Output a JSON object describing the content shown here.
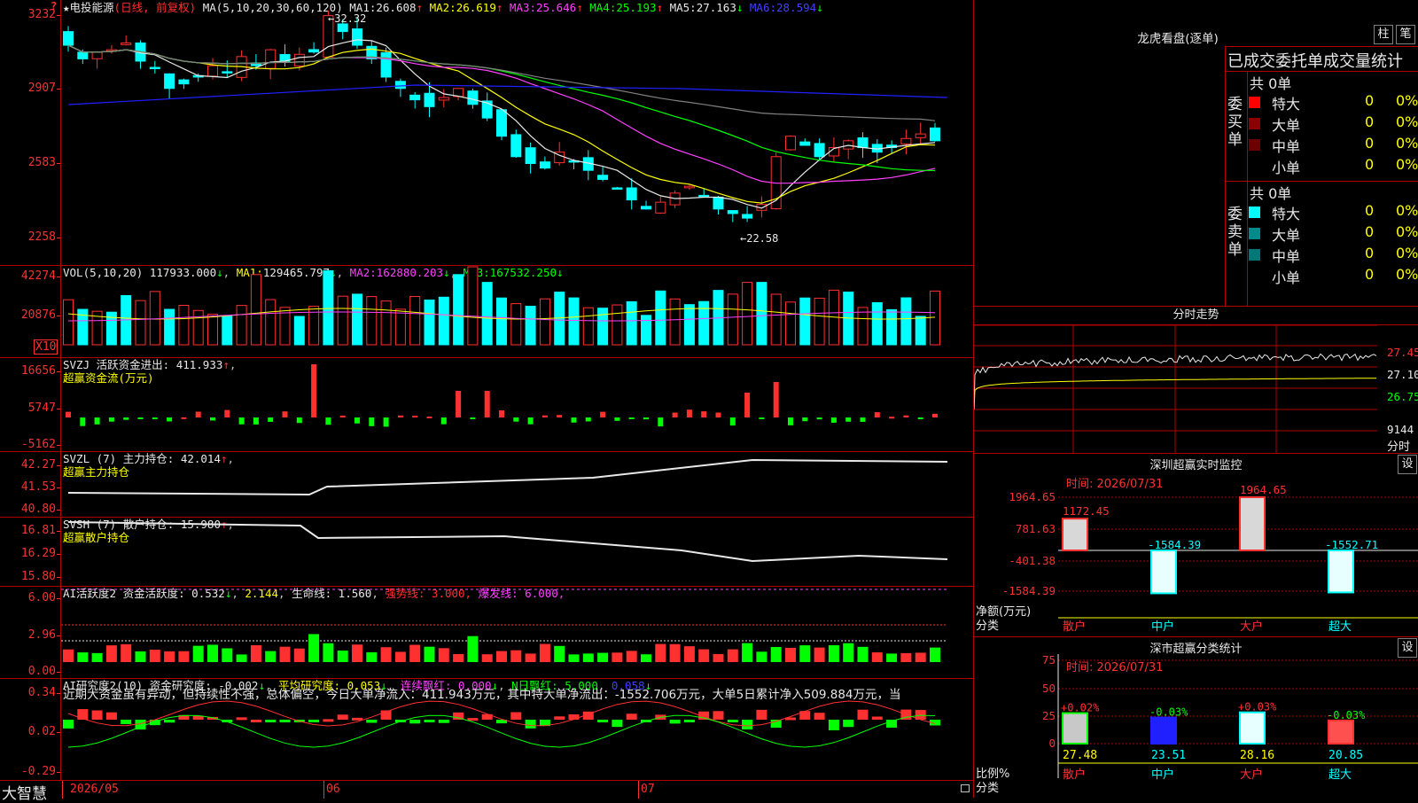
{
  "colors": {
    "up": "#ff3030",
    "down": "#00ffff",
    "ma1": "#e8e8e8",
    "ma2": "#ffff00",
    "ma3": "#ff40ff",
    "ma4": "#00ff00",
    "ma5": "#808080",
    "ma6": "#2020ff",
    "grid": "#b00000"
  },
  "main": {
    "corner_mark": "?",
    "star": "★",
    "stock_name": "电投能源",
    "period": "(日线, 前复权)",
    "ma_params": "MA(5,10,20,30,60,120)",
    "ma": [
      {
        "label": "MA1:",
        "value": "26.608",
        "dir": "↑"
      },
      {
        "label": "MA2:",
        "value": "26.619",
        "dir": "↑"
      },
      {
        "label": "MA3:",
        "value": "25.646",
        "dir": "↑"
      },
      {
        "label": "MA4:",
        "value": "25.193",
        "dir": "↑"
      },
      {
        "label": "MA5:",
        "value": "27.163",
        "dir": "↓"
      },
      {
        "label": "MA6:",
        "value": "28.594",
        "dir": "↓"
      }
    ],
    "y_ticks": [
      "3232",
      "2907",
      "2583",
      "2258"
    ],
    "high_note": "32.32",
    "low_note": "←22.58"
  },
  "vol": {
    "params": "VOL(5,10,20)",
    "value": "117933.000",
    "dir": "↓",
    "ma": [
      {
        "label": "MA1:",
        "value": "129465.797",
        "dir": "↓"
      },
      {
        "label": "MA2:",
        "value": "162880.203",
        "dir": "↓"
      },
      {
        "label": "MA3:",
        "value": "167532.250",
        "dir": "↓"
      }
    ],
    "y_ticks": [
      "42274",
      "20876"
    ],
    "unit": "X10"
  },
  "svzj": {
    "title": "SVZJ",
    "desc": "活跃资金进出:",
    "value": "411.933",
    "dir": "↑",
    "sub": "超赢资金流(万元)",
    "y_ticks": [
      "16656",
      "5747",
      "-5162"
    ]
  },
  "svzl": {
    "title": "SVZL (7)",
    "desc": "主力持仓:",
    "value": "42.014",
    "dir": "↑",
    "sub": "超赢主力持仓",
    "y_ticks": [
      "42.27",
      "41.53",
      "40.80"
    ]
  },
  "svsh": {
    "title": "SVSH (7)",
    "desc": "散户持仓:",
    "value": "15.980",
    "dir": "↑",
    "sub": "超赢散户持仓",
    "y_ticks": [
      "16.81",
      "16.29",
      "15.80"
    ]
  },
  "ai_active": {
    "title": "AI活跃度2",
    "desc": "资金活跃度:",
    "value": "0.532",
    "v2": "2.144",
    "life_label": "生命线:",
    "life": "1.560",
    "strong": "强势线: 3.000,",
    "burst": "爆发线: 6.000,",
    "y_ticks": [
      "6.00",
      "2.96",
      "0.00"
    ]
  },
  "ai_research": {
    "title": "AI研究度2(10)",
    "desc": "资金研究度:",
    "value": "-0.002",
    "avg_label": "平均研究度:",
    "avg": "0.053",
    "cont_label": "连续飘红:",
    "cont": "0.000",
    "n_label": "N日飘红:",
    "n": "5.000",
    "last": "0.058",
    "y_ticks": [
      "0.34",
      "0.02",
      "-0.29"
    ],
    "comment": "近期大资金虽有异动，但持续性不强，总体偏空，今日大单净流入：411.943万元，其中特大单净流出：-1552.706万元，大单5日累计净入509.884万元，当"
  },
  "x_axis": {
    "logo": "大智慧",
    "labels": [
      "2026/05",
      "06",
      "07"
    ]
  },
  "lhb": {
    "title": "龙虎看盘(逐单)",
    "btn1": "柱",
    "btn2": "笔",
    "tabs": "已成交委托单成交量统计",
    "buy": {
      "side": "委买单",
      "total": "共 0单",
      "rows": [
        {
          "name": "特大",
          "v": "0",
          "p": "0%"
        },
        {
          "name": "大单",
          "v": "0",
          "p": "0%"
        },
        {
          "name": "中单",
          "v": "0",
          "p": "0%"
        },
        {
          "name": "小单",
          "v": "0",
          "p": "0%"
        }
      ]
    },
    "sell": {
      "side": "委卖单",
      "total": "共 0单",
      "rows": [
        {
          "name": "特大",
          "v": "0",
          "p": "0%"
        },
        {
          "name": "大单",
          "v": "0",
          "p": "0%"
        },
        {
          "name": "中单",
          "v": "0",
          "p": "0%"
        },
        {
          "name": "小单",
          "v": "0",
          "p": "0%"
        }
      ]
    }
  },
  "intraday": {
    "title": "分时走势",
    "prices": [
      "27.45",
      "27.10",
      "26.75"
    ],
    "vol": "9144",
    "unit": "分时"
  },
  "sz_monitor": {
    "title": "深圳超赢实时监控",
    "btn": "设",
    "time": "时间: 2026/07/31",
    "y_ticks": [
      "1964.65",
      "781.63",
      "-401.38",
      "-1584.39"
    ],
    "ylabel": "净额(万元)",
    "xlabel": "分类",
    "bars": [
      {
        "cat": "散户",
        "value": "1172.45"
      },
      {
        "cat": "中户",
        "value": "-1584.39"
      },
      {
        "cat": "大户",
        "value": "1964.65"
      },
      {
        "cat": "超大",
        "value": "-1552.71"
      }
    ]
  },
  "sz_stats": {
    "title": "深市超赢分类统计",
    "btn": "设",
    "time": "时间: 2026/07/31",
    "y_ticks": [
      "75",
      "50",
      "25",
      "0"
    ],
    "ylabel": "比例%",
    "xlabel": "分类",
    "bars": [
      {
        "cat": "散户",
        "pct": "+0.02%",
        "value": "27.48"
      },
      {
        "cat": "中户",
        "pct": "-0.03%",
        "value": "23.51"
      },
      {
        "cat": "大户",
        "pct": "+0.03%",
        "value": "28.16"
      },
      {
        "cat": "超大",
        "pct": "-0.03%",
        "value": "20.85"
      }
    ]
  }
}
